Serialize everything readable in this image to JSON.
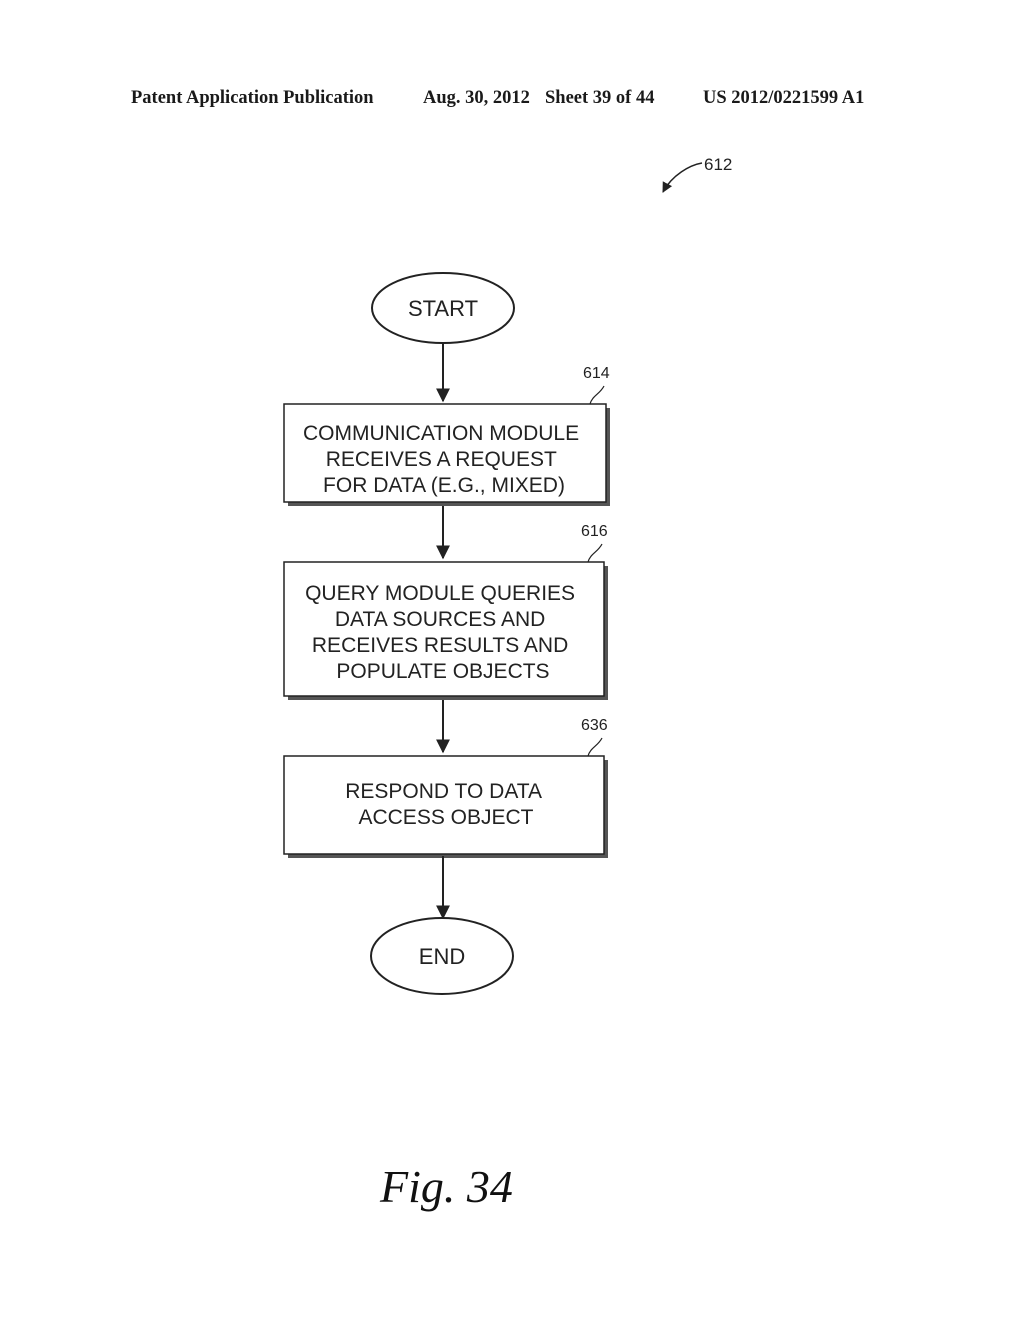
{
  "header": {
    "publication": "Patent Application Publication",
    "date": "Aug. 30, 2012",
    "sheet": "Sheet 39 of 44",
    "number": "US 2012/0221599 A1"
  },
  "figure": {
    "reference": "612",
    "label": "Fig. 34",
    "nodes": {
      "start": {
        "text": "START"
      },
      "step1": {
        "ref": "614",
        "lines": [
          "COMMUNICATION MODULE",
          "RECEIVES A REQUEST",
          "FOR DATA (E.G., MIXED)"
        ]
      },
      "step2": {
        "ref": "616",
        "lines": [
          "QUERY MODULE QUERIES",
          "DATA SOURCES AND",
          "RECEIVES RESULTS AND",
          "POPULATE OBJECTS"
        ]
      },
      "step3": {
        "ref": "636",
        "lines": [
          "RESPOND TO DATA",
          "ACCESS OBJECT"
        ]
      },
      "end": {
        "text": "END"
      }
    }
  }
}
